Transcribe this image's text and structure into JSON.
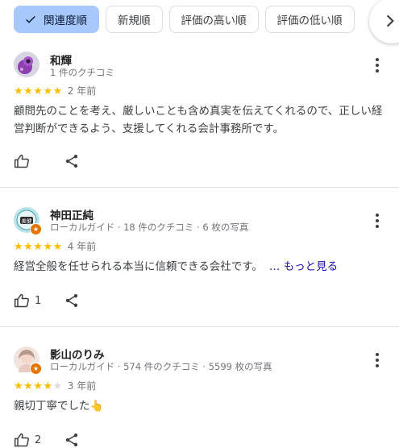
{
  "sort_chips": [
    {
      "label": "関連度順",
      "selected": true
    },
    {
      "label": "新規順",
      "selected": false
    },
    {
      "label": "評価の高い順",
      "selected": false
    },
    {
      "label": "評価の低い順",
      "selected": false
    }
  ],
  "reviews": [
    {
      "name": "和輝",
      "meta": "1 件のクチコミ",
      "rating": 5,
      "time": "2 年前",
      "text": "顧問先のことを考え、厳しいことも含め真実を伝えてくれるので、正しい経営判断ができるよう、支援してくれる会計事務所です。",
      "likes": ""
    },
    {
      "name": "神田正純",
      "meta": "ローカルガイド · 18 件のクチコミ · 6 枚の写真",
      "rating": 5,
      "time": "4 年前",
      "text": "経営全般を任せられる本当に信頼できる会社です。",
      "more_label": "… もっと見る",
      "likes": "1"
    },
    {
      "name": "影山のりみ",
      "meta": "ローカルガイド · 574 件のクチコミ · 5599 枚の写真",
      "rating": 4,
      "time": "3 年前",
      "text": "親切丁寧でした👆",
      "likes": "2"
    }
  ],
  "colors": {
    "accent_chip": "#a8c7fa",
    "star": "#fbbc04",
    "link": "#1a0dab",
    "local_guide_badge": "#e37400"
  }
}
